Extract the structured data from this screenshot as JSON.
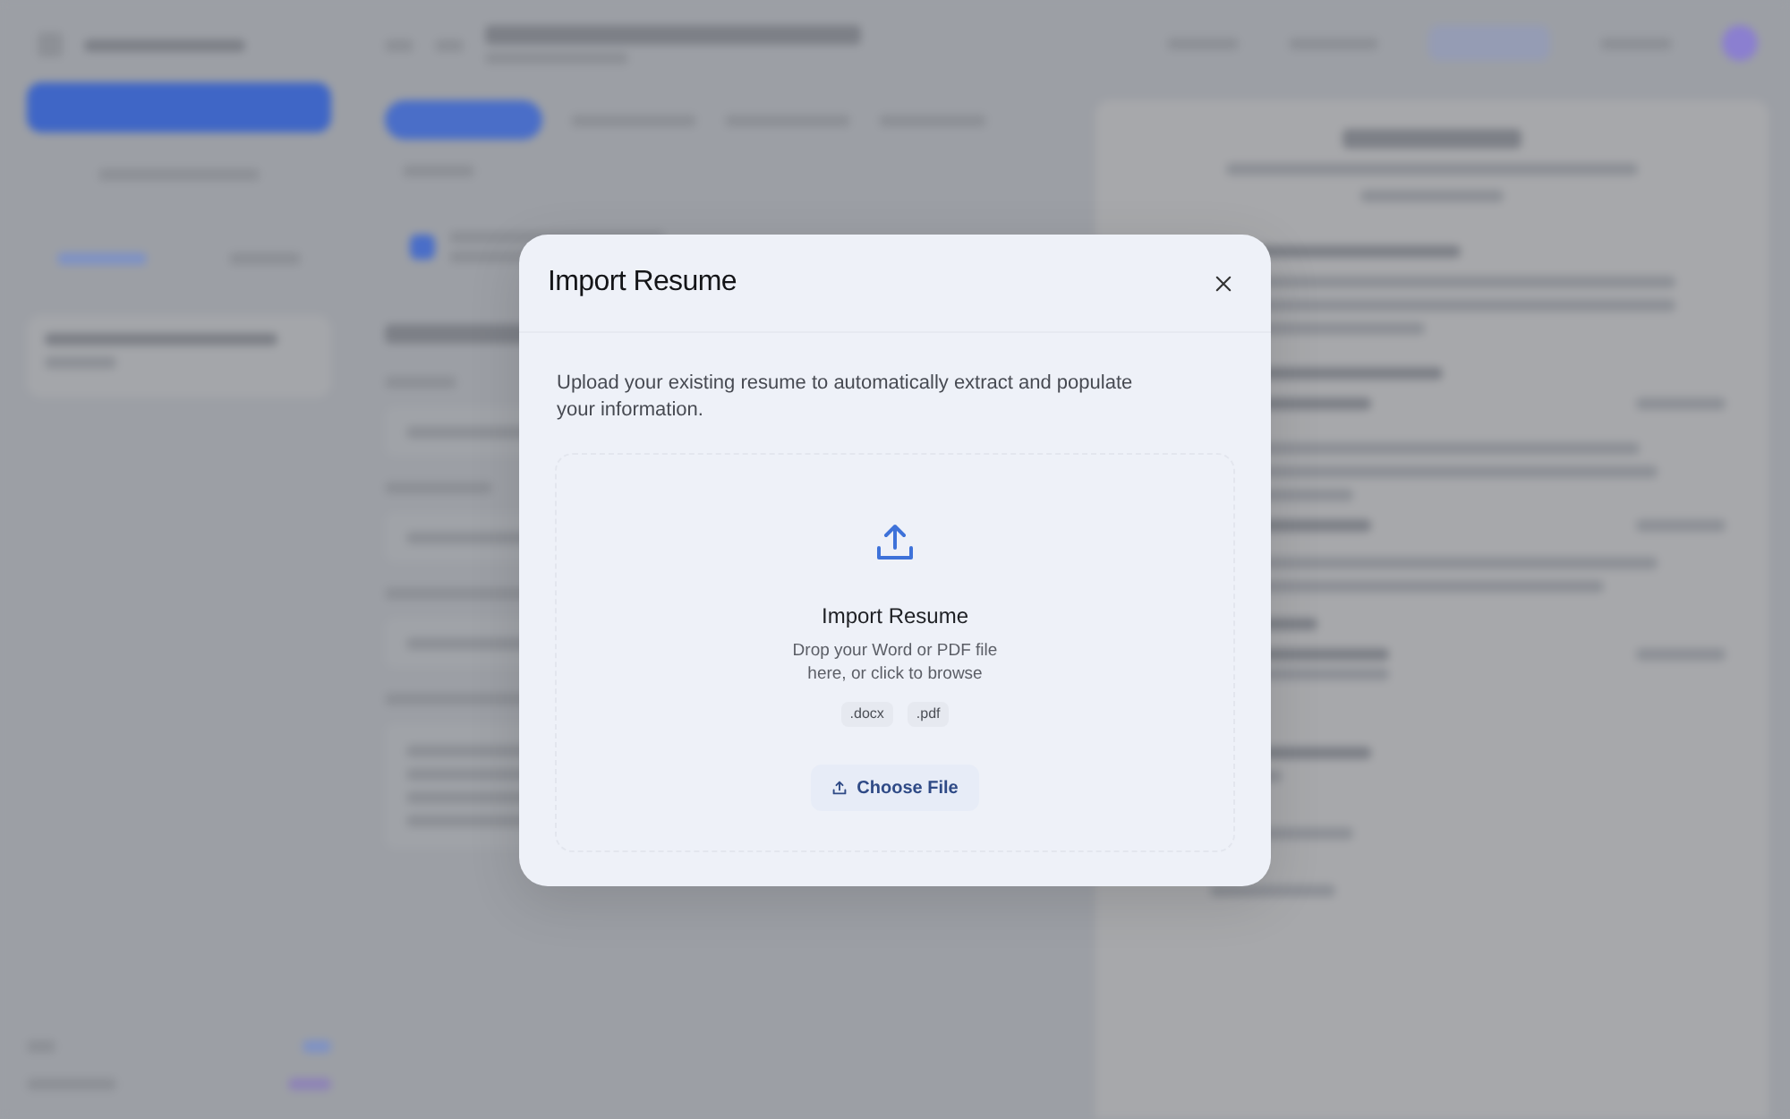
{
  "dialog": {
    "title": "Import Resume",
    "description": "Upload your existing resume to automatically extract and populate your information.",
    "dropzone": {
      "title": "Import Resume",
      "hint": "Drop your Word or PDF file here, or click to browse",
      "formats": [
        ".docx",
        ".pdf"
      ],
      "button": "Choose File"
    }
  }
}
